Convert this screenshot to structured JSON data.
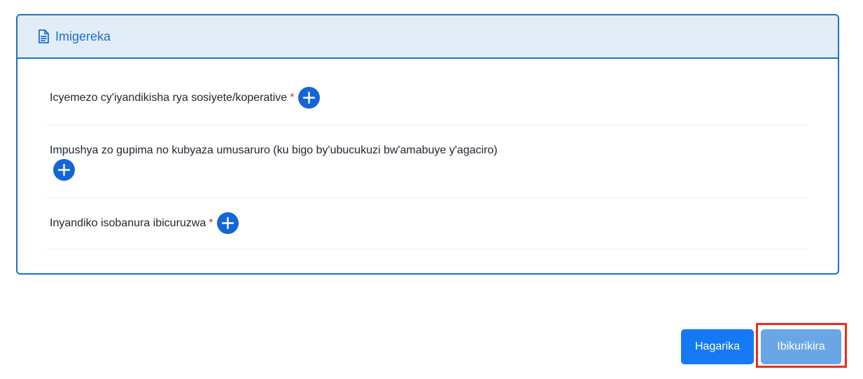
{
  "section": {
    "title": "Imigereka",
    "icon": "document-icon"
  },
  "attachments": [
    {
      "label": "Icyemezo cy'iyandikisha rya sosiyete/koperative",
      "required": true,
      "required_marker": "*",
      "action_icon": "plus-circle-icon"
    },
    {
      "label": "Impushya zo gupima no kubyaza umusaruro (ku bigo by'ubucukuzi bw'amabuye y'agaciro)",
      "required": false,
      "action_icon": "plus-circle-icon"
    },
    {
      "label": "Inyandiko isobanura ibicuruzwa",
      "required": true,
      "required_marker": "*",
      "action_icon": "plus-circle-icon"
    }
  ],
  "actions": {
    "cancel_label": "Hagarika",
    "confirm_label": "Ibikurikira"
  },
  "colors": {
    "accent": "#1f6fd0",
    "header_bg": "#e2edf8",
    "add_button": "#1565d8",
    "required": "#e0263a",
    "cancel_button": "#1579f5",
    "confirm_button": "#6aa6e6",
    "highlight": "#f52b12"
  }
}
